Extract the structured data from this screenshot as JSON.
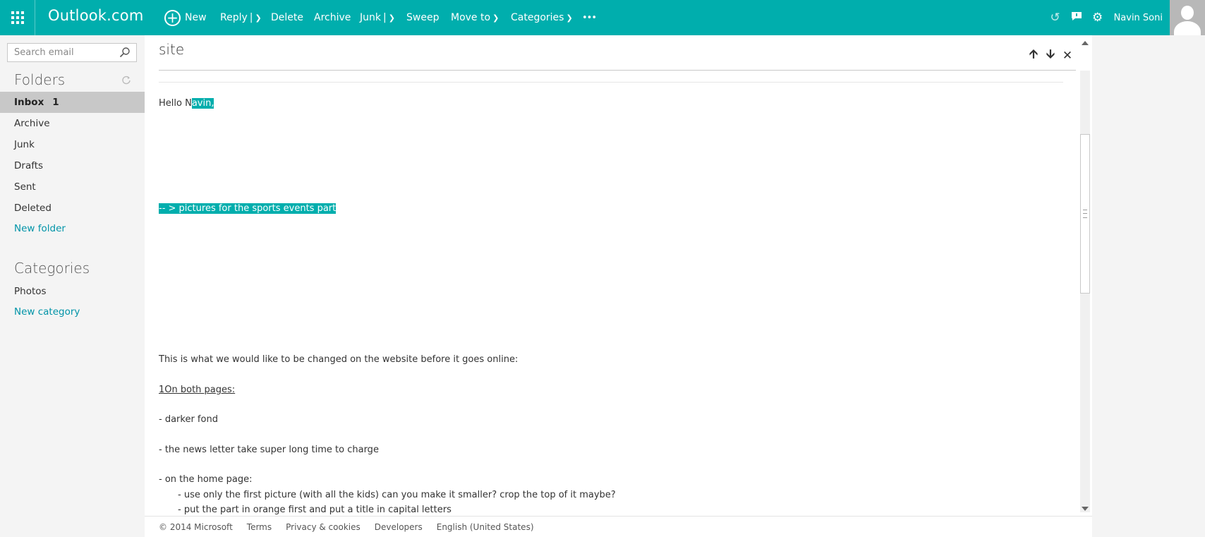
{
  "app": {
    "brand": "Outlook.com"
  },
  "toolbar": {
    "new": "New",
    "reply": "Reply",
    "delete": "Delete",
    "archive": "Archive",
    "junk": "Junk",
    "sweep": "Sweep",
    "move_to": "Move to",
    "categories": "Categories",
    "more": "•••"
  },
  "user": {
    "name": "Navin Soni"
  },
  "search": {
    "placeholder": "Search email"
  },
  "folders": {
    "title": "Folders",
    "items": [
      {
        "label": "Inbox",
        "count": "1"
      },
      {
        "label": "Archive"
      },
      {
        "label": "Junk"
      },
      {
        "label": "Drafts"
      },
      {
        "label": "Sent"
      },
      {
        "label": "Deleted"
      }
    ],
    "new_folder": "New folder"
  },
  "categories": {
    "title": "Categories",
    "items": [
      {
        "label": "Photos"
      }
    ],
    "new_category": "New category"
  },
  "message": {
    "subject": "site",
    "greeting_a": "Hello N",
    "greeting_b": "avin, ",
    "highlight_line": "-- > pictures for the sports events part",
    "intro": "This is what we would like to be changed on the website before it goes online:",
    "section1": "1On both pages: ",
    "line_a": "- darker fond",
    "line_b": "- the news letter take super long time to charge",
    "line_c": "-  on the home page:",
    "line_d": "- use only the first picture (with all the kids) can you make it smaller? crop the top of it maybe?",
    "line_e": "- put the part in orange first and put a title in capital letters"
  },
  "footer": {
    "copyright": "© 2014 Microsoft",
    "terms": "Terms",
    "privacy": "Privacy & cookies",
    "developers": "Developers",
    "language": "English (United States)"
  }
}
